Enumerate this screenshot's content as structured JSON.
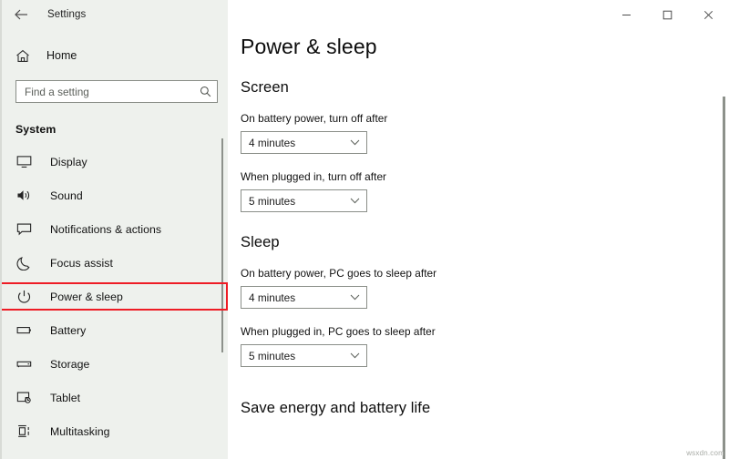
{
  "window": {
    "app_title": "Settings",
    "back_icon": "back-arrow-icon",
    "minimize_label": "–",
    "maximize_label": "☐",
    "close_label": "✕"
  },
  "sidebar": {
    "home": {
      "label": "Home",
      "icon": "home-icon"
    },
    "search": {
      "placeholder": "Find a setting",
      "value": "",
      "icon": "search-icon"
    },
    "group_title": "System",
    "items": [
      {
        "label": "Display",
        "icon": "monitor-icon",
        "active": false
      },
      {
        "label": "Sound",
        "icon": "speaker-icon",
        "active": false
      },
      {
        "label": "Notifications & actions",
        "icon": "notification-icon",
        "active": false
      },
      {
        "label": "Focus assist",
        "icon": "moon-icon",
        "active": false
      },
      {
        "label": "Power & sleep",
        "icon": "power-icon",
        "active": true
      },
      {
        "label": "Battery",
        "icon": "battery-icon",
        "active": false
      },
      {
        "label": "Storage",
        "icon": "storage-icon",
        "active": false
      },
      {
        "label": "Tablet",
        "icon": "tablet-icon",
        "active": false
      },
      {
        "label": "Multitasking",
        "icon": "multitasking-icon",
        "active": false
      }
    ],
    "highlight_color": "#ee1c25"
  },
  "main": {
    "page_title": "Power & sleep",
    "sections": [
      {
        "heading": "Screen",
        "fields": [
          {
            "label": "On battery power, turn off after",
            "value": "4 minutes"
          },
          {
            "label": "When plugged in, turn off after",
            "value": "5 minutes"
          }
        ]
      },
      {
        "heading": "Sleep",
        "fields": [
          {
            "label": "On battery power, PC goes to sleep after",
            "value": "4 minutes"
          },
          {
            "label": "When plugged in, PC goes to sleep after",
            "value": "5 minutes"
          }
        ]
      }
    ],
    "bottom_heading": "Save energy and battery life"
  },
  "watermark": "wsxdn.com"
}
